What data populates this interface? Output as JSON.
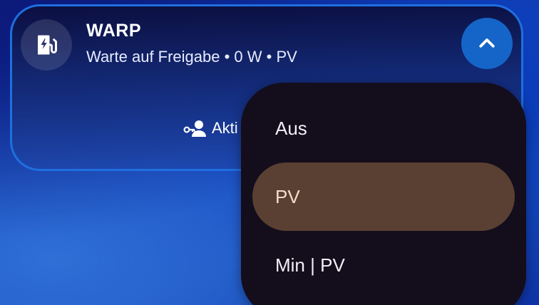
{
  "notification": {
    "title": "WARP",
    "subtitle": "Warte auf Freigabe • 0 W • PV",
    "app_icon": "ev-charger-icon",
    "expand_icon": "chevron-up-icon",
    "action": {
      "label": "Akti",
      "icon": "person-key-icon"
    }
  },
  "dropdown": {
    "items": [
      {
        "label": "Aus",
        "selected": false
      },
      {
        "label": "PV",
        "selected": true
      },
      {
        "label": "Min | PV",
        "selected": false
      }
    ]
  },
  "colors": {
    "card_border": "#1f6fe0",
    "expand_button": "#1565c8",
    "menu_background": "#140d1c",
    "selected_item": "#5a4032"
  }
}
